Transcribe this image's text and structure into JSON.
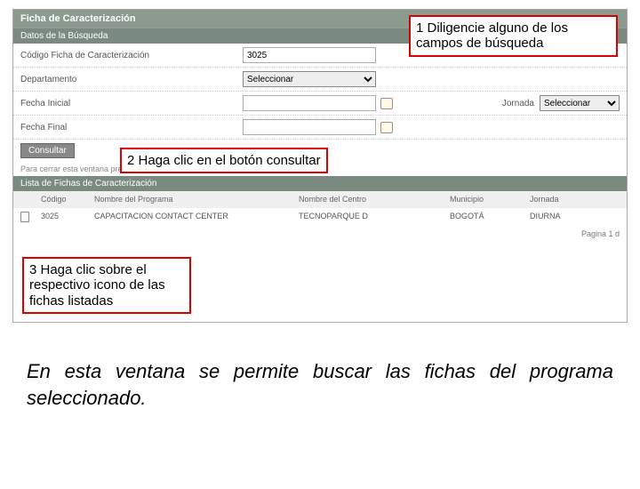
{
  "header": {
    "title": "Ficha de Caracterización"
  },
  "search": {
    "section_label": "Datos de la Búsqueda",
    "field_codigo_label": "Código Ficha de Caracterización",
    "field_codigo_value": "3025",
    "field_departamento_label": "Departamento",
    "field_departamento_value": "Seleccionar",
    "field_fecha_inicial_label": "Fecha Inicial",
    "field_fecha_inicial_value": "",
    "field_fecha_final_label": "Fecha Final",
    "field_fecha_final_value": "",
    "jornada_label": "Jornada",
    "jornada_value": "Seleccionar",
    "consultar_label": "Consultar",
    "close_hint": "Para cerrar esta ventana presione la tecla Esc."
  },
  "list": {
    "section_label": "Lista de Fichas de Caracterización",
    "cols": {
      "codigo": "Código",
      "programa": "Nombre del Programa",
      "centro": "Nombre del Centro",
      "municipio": "Municipio",
      "jornada": "Jornada"
    },
    "row1": {
      "codigo": "3025",
      "programa": "CAPACITACION CONTACT CENTER",
      "centro": "TECNOPARQUE D",
      "municipio": "BOGOTÁ",
      "jornada": "DIURNA"
    },
    "pager_text": "Pagina 1 d"
  },
  "callouts": {
    "c1": "1 Diligencie alguno de los campos de búsqueda",
    "c2": "2 Haga clic en el botón consultar",
    "c3": "3 Haga clic sobre el respectivo icono de las fichas listadas"
  },
  "caption": "En esta ventana se permite buscar las fichas del programa seleccionado."
}
